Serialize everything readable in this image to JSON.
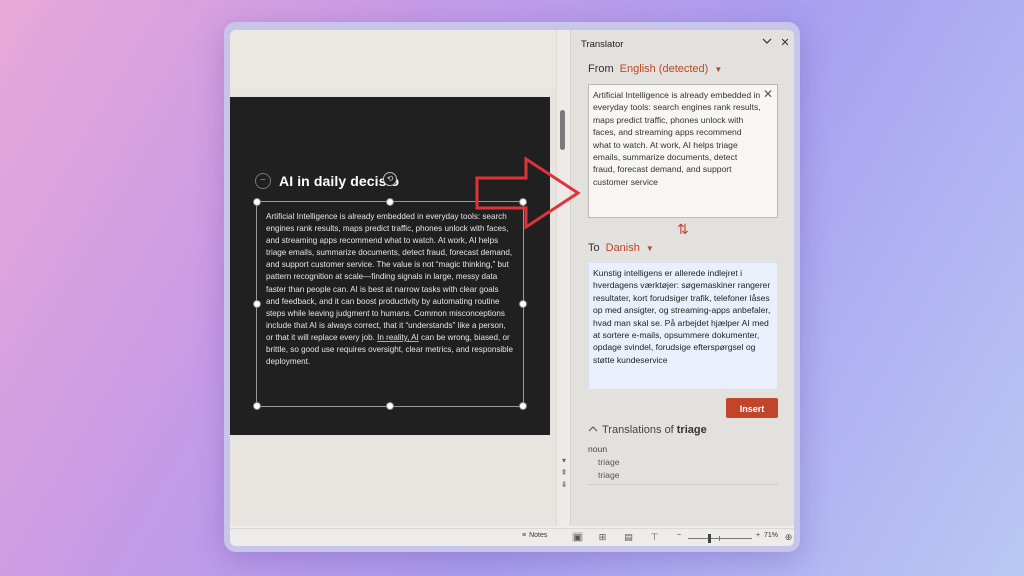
{
  "editor": {
    "slide_title": "AI in daily decisio",
    "rotate_glyph": "⟲",
    "collapse_glyph": "−",
    "body_part1": "Artificial Intelligence is already embedded in everyday tools: search engines rank results, maps predict traffic, phones unlock with faces, and streaming apps recommend what to watch. At work, AI helps triage emails, summarize documents, detect fraud, forecast demand, and support customer service. The value is not “magic thinking,” but pattern recognition at scale—finding signals in large, messy data faster than people can. AI is best at narrow tasks with clear goals and feedback, and it can boost productivity by automating routine steps while leaving judgment to humans. Common misconceptions include that AI is always correct, that it “understands” like a person, or that it will replace every job. ",
    "body_underlined": "In reality, AI",
    "body_part2": " can be wrong, biased, or brittle, so good use requires oversight, clear metrics, and responsible deployment."
  },
  "translator": {
    "title": "Translator",
    "from_label": "From",
    "from_value": "English (detected)",
    "source_text": "Artificial Intelligence is already embedded in everyday tools: search engines rank results, maps predict traffic, phones unlock with faces, and streaming apps recommend what to watch. At work, AI helps triage emails, summarize documents, detect fraud, forecast demand, and support customer service",
    "to_label": "To",
    "to_value": "Danish",
    "target_text": "Kunstig intelligens er allerede indlejret i hverdagens værktøjer: søgemaskiner rangerer resultater, kort forudsiger trafik, telefoner låses op med ansigter, og streaming-apps anbefaler, hvad man skal se. På arbejdet hjælper AI med at sortere e-mails, opsummere dokumenter, opdage svindel, forudsige efterspørgsel og støtte kundeservice",
    "insert_label": "Insert",
    "translations_prefix": "Translations of",
    "translations_word": "triage",
    "part_of_speech": "noun",
    "translations": [
      "triage",
      "triage"
    ]
  },
  "statusbar": {
    "notes_label": "Notes",
    "zoom_minus": "−",
    "zoom_plus": "+",
    "zoom_level": "71%"
  },
  "colors": {
    "accent": "#c0452a",
    "annotation_arrow": "#e0323a"
  },
  "icons": [
    "collapse-circle-icon",
    "rotate-icon",
    "chevron-down-icon",
    "close-icon",
    "clear-icon",
    "swap-icon",
    "chevron-up-icon",
    "notes-icon",
    "normal-view-icon",
    "slide-sorter-icon",
    "reading-view-icon",
    "slideshow-icon",
    "fit-slide-icon",
    "red-arrow-annotation"
  ]
}
